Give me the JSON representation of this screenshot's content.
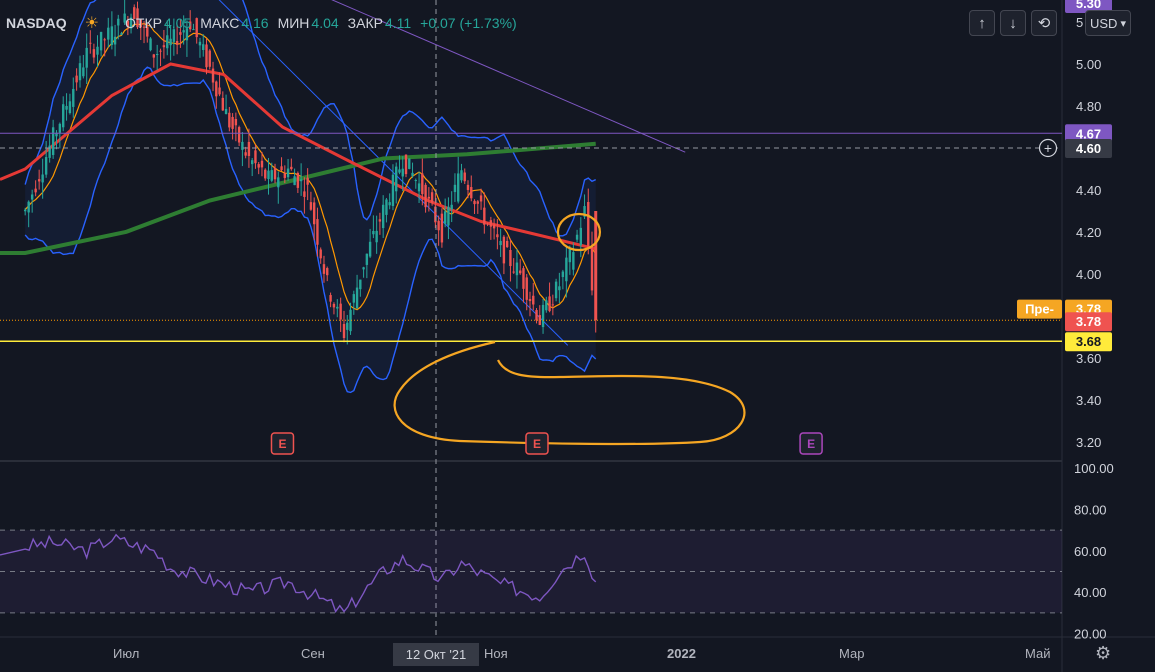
{
  "header": {
    "symbol": "NASDAQ",
    "open_label": "ОТКР",
    "open": "4.05",
    "high_label": "МАКС",
    "high": "4.16",
    "low_label": "МИН",
    "low": "4.04",
    "close_label": "ЗАКР",
    "close": "4.11",
    "change": "+0.07 (+1.73%)",
    "currency": "USD",
    "currency_caret": "▾"
  },
  "icons": {
    "session": "sun-icon",
    "up": "arrow-up-icon",
    "down": "arrow-down-icon",
    "replay": "loop-icon",
    "add": "plus-icon",
    "settings": "gear-icon",
    "earnings": "earnings-e-icon"
  },
  "icon_glyphs": {
    "sun": "☀",
    "up": "↑",
    "down": "↓",
    "replay": "⟲",
    "add": "+",
    "settings": "⚙",
    "earnings": "E"
  },
  "price_axis": {
    "ticks": [
      "5.00",
      "4.80",
      "4.40",
      "4.20",
      "4.00",
      "3.60",
      "3.40",
      "3.20"
    ],
    "top_partial": "5",
    "top_partial_tag": "5.30",
    "resistance_tag": "4.67",
    "crosshair_tag": "4.60",
    "premarket_label": "Пре-",
    "premarket_value": "3.78",
    "last_value": "3.78",
    "support_tag": "3.68"
  },
  "rsi_axis": {
    "ticks": [
      "100.00",
      "80.00",
      "60.00",
      "40.00",
      "20.00"
    ]
  },
  "time_axis": {
    "labels": [
      "Июл",
      "Сен",
      "Ноя",
      "2022",
      "Мар",
      "Май"
    ],
    "crosshair_date": "12 Окт '21"
  },
  "colors": {
    "background": "#131722",
    "up": "#26a69a",
    "down": "#ef5350",
    "bollinger": "#2962ff",
    "ma_fast": "#ff9800",
    "ma_mid": "#e53935",
    "ma_slow": "#2e7d32",
    "support": "#ffeb3b",
    "resistance": "#7e57c2",
    "rsi": "#7e57c2",
    "annotation": "#f5a623",
    "earnings_past": "#ef5350",
    "earnings_future": "#ab47bc"
  },
  "chart_data": {
    "type": "candlestick",
    "symbol": "NASDAQ",
    "currency": "USD",
    "x_range": [
      "2021-05",
      "2022-05"
    ],
    "y_range": [
      3.1,
      5.3
    ],
    "last_candle": {
      "open": 4.05,
      "high": 4.16,
      "low": 4.04,
      "close": 4.11,
      "change": 0.07,
      "change_pct": 1.73
    },
    "price_path": [
      {
        "date": "2021-05-10",
        "close": 4.3
      },
      {
        "date": "2021-05-20",
        "close": 4.65
      },
      {
        "date": "2021-06-01",
        "close": 5.05
      },
      {
        "date": "2021-06-10",
        "close": 5.15
      },
      {
        "date": "2021-06-18",
        "close": 5.25
      },
      {
        "date": "2021-06-25",
        "close": 5.05
      },
      {
        "date": "2021-07-01",
        "close": 5.1
      },
      {
        "date": "2021-07-08",
        "close": 5.2
      },
      {
        "date": "2021-07-15",
        "close": 4.98
      },
      {
        "date": "2021-07-22",
        "close": 4.72
      },
      {
        "date": "2021-07-29",
        "close": 4.55
      },
      {
        "date": "2021-08-05",
        "close": 4.45
      },
      {
        "date": "2021-08-12",
        "close": 4.5
      },
      {
        "date": "2021-08-19",
        "close": 4.4
      },
      {
        "date": "2021-08-26",
        "close": 3.95
      },
      {
        "date": "2021-09-01",
        "close": 3.72
      },
      {
        "date": "2021-09-08",
        "close": 4.05
      },
      {
        "date": "2021-09-15",
        "close": 4.3
      },
      {
        "date": "2021-09-22",
        "close": 4.55
      },
      {
        "date": "2021-09-29",
        "close": 4.4
      },
      {
        "date": "2021-10-06",
        "close": 4.2
      },
      {
        "date": "2021-10-13",
        "close": 4.5
      },
      {
        "date": "2021-10-20",
        "close": 4.3
      },
      {
        "date": "2021-10-27",
        "close": 4.12
      },
      {
        "date": "2021-11-03",
        "close": 4.0
      },
      {
        "date": "2021-11-10",
        "close": 3.78
      },
      {
        "date": "2021-11-17",
        "close": 3.95
      },
      {
        "date": "2021-11-22",
        "close": 4.12
      },
      {
        "date": "2021-11-26",
        "close": 4.3
      },
      {
        "date": "2021-11-30",
        "close": 3.78
      }
    ],
    "ma_slow_path": [
      [
        "2021-05-10",
        4.1
      ],
      [
        "2021-06-15",
        4.2
      ],
      [
        "2021-07-15",
        4.35
      ],
      [
        "2021-08-15",
        4.45
      ],
      [
        "2021-09-15",
        4.55
      ],
      [
        "2021-10-15",
        4.57
      ],
      [
        "2021-11-30",
        4.62
      ]
    ],
    "ma_mid_path": [
      [
        "2021-05-10",
        4.5
      ],
      [
        "2021-06-10",
        4.85
      ],
      [
        "2021-07-01",
        5.0
      ],
      [
        "2021-07-20",
        4.95
      ],
      [
        "2021-08-10",
        4.7
      ],
      [
        "2021-09-01",
        4.55
      ],
      [
        "2021-10-01",
        4.35
      ],
      [
        "2021-10-20",
        4.25
      ],
      [
        "2021-11-05",
        4.2
      ],
      [
        "2021-11-30",
        4.12
      ]
    ],
    "horizontal_levels": {
      "resistance": 4.67,
      "crosshair": 4.6,
      "last": 3.78,
      "support": 3.68
    },
    "earnings": [
      {
        "date": "2021-08-10",
        "state": "past"
      },
      {
        "date": "2021-11-09",
        "state": "past"
      },
      {
        "date": "2022-02-15",
        "state": "upcoming"
      }
    ],
    "rsi": {
      "y_range": [
        20,
        100
      ],
      "levels": [
        70,
        50,
        30
      ],
      "values": [
        [
          "2021-05-10",
          62
        ],
        [
          "2021-05-20",
          64
        ],
        [
          "2021-06-01",
          60
        ],
        [
          "2021-06-10",
          66
        ],
        [
          "2021-06-25",
          60
        ],
        [
          "2021-07-01",
          52
        ],
        [
          "2021-07-15",
          46
        ],
        [
          "2021-07-29",
          40
        ],
        [
          "2021-08-12",
          45
        ],
        [
          "2021-08-26",
          35
        ],
        [
          "2021-09-01",
          30
        ],
        [
          "2021-09-15",
          50
        ],
        [
          "2021-09-22",
          56
        ],
        [
          "2021-10-06",
          46
        ],
        [
          "2021-10-13",
          54
        ],
        [
          "2021-10-27",
          44
        ],
        [
          "2021-11-10",
          38
        ],
        [
          "2021-11-17",
          50
        ],
        [
          "2021-11-26",
          60
        ],
        [
          "2021-11-30",
          45
        ]
      ]
    }
  }
}
